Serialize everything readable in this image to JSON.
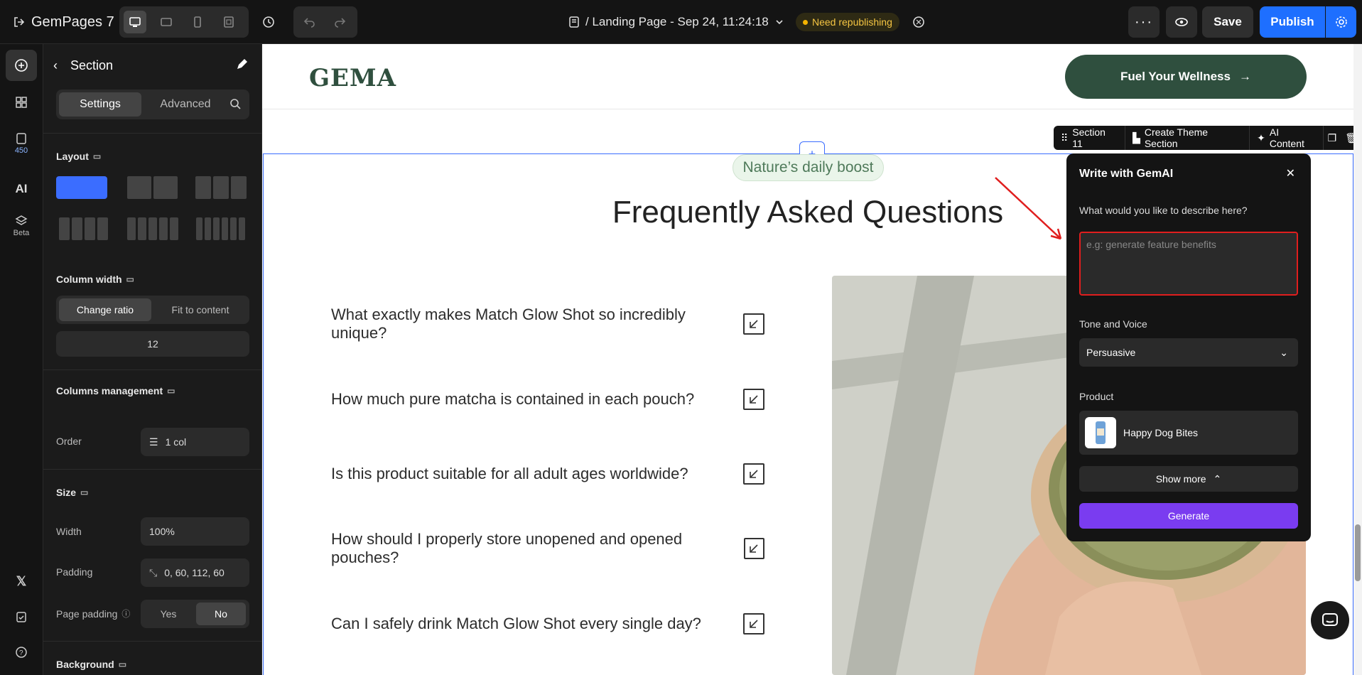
{
  "app": {
    "name": "GemPages 7",
    "page_title": "/ Landing Page - Sep 24, 11:24:18",
    "status_badge": "Need republishing",
    "save_label": "Save",
    "publish_label": "Publish"
  },
  "rail": {
    "badge_count": "450",
    "beta_label": "Beta"
  },
  "panel": {
    "title": "Section",
    "tabs": [
      "Settings",
      "Advanced"
    ],
    "layout_label": "Layout",
    "column_width_label": "Column width",
    "column_width_options": [
      "Change ratio",
      "Fit to content"
    ],
    "column_ratio_value": "12",
    "columns_mgmt_label": "Columns management",
    "order_label": "Order",
    "order_value": "1 col",
    "size_label": "Size",
    "width_label": "Width",
    "width_value": "100%",
    "padding_label": "Padding",
    "padding_value": "0, 60, 112, 60",
    "page_padding_label": "Page padding",
    "page_padding_options": [
      "Yes",
      "No"
    ],
    "background_label": "Background"
  },
  "site": {
    "brand": "GEMA",
    "cta": "Fuel Your Wellness",
    "eyebrow": "Nature’s daily boost",
    "faq_title": "Frequently Asked Questions",
    "faqs": [
      "What exactly makes Match Glow Shot so incredibly unique?",
      "How much pure matcha is contained in each pouch?",
      "Is this product suitable for all adult ages worldwide?",
      "How should I properly store unopened and opened pouches?",
      "Can I safely drink Match Glow Shot every single day?"
    ]
  },
  "section_toolbar": {
    "section_label": "Section 11",
    "create_theme": "Create Theme Section",
    "ai_content": "AI Content"
  },
  "gemai": {
    "title": "Write with GemAI",
    "prompt_label": "What would you like to describe here?",
    "prompt_placeholder": "e.g: generate feature benefits",
    "tone_label": "Tone and Voice",
    "tone_value": "Persuasive",
    "product_label": "Product",
    "product_name": "Happy Dog Bites",
    "show_more": "Show more",
    "generate": "Generate"
  },
  "colors": {
    "accent": "#1e6fff",
    "brand_green": "#2f4f3e",
    "generate": "#7a3cf0",
    "highlight": "#e01e1e"
  }
}
